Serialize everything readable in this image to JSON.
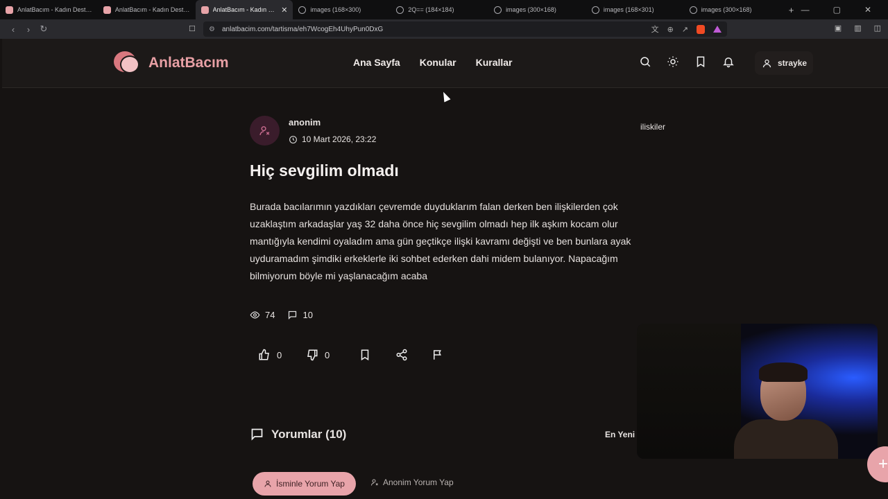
{
  "browser": {
    "tabs": [
      {
        "title": "AnlatBacım - Kadın Destek Platformu",
        "type": "site",
        "active": false
      },
      {
        "title": "AnlatBacım - Kadın Destek Platformu",
        "type": "site",
        "active": false
      },
      {
        "title": "AnlatBacım - Kadın Destek",
        "type": "site",
        "active": true
      },
      {
        "title": "images (168×300)",
        "type": "image",
        "active": false
      },
      {
        "title": "2Q== (184×184)",
        "type": "image",
        "active": false
      },
      {
        "title": "images (300×168)",
        "type": "image",
        "active": false
      },
      {
        "title": "images (168×301)",
        "type": "image",
        "active": false
      },
      {
        "title": "images (300×168)",
        "type": "image",
        "active": false
      }
    ],
    "new_tab": "+",
    "close": "✕",
    "url": "anlatbacim.com/tartisma/eh7WcogEh4UhyPun0DxG"
  },
  "site": {
    "logo_text": "AnlatBacım",
    "nav": [
      "Ana Sayfa",
      "Konular",
      "Kurallar"
    ],
    "username": "strayke"
  },
  "post": {
    "author": "anonim",
    "date": "10 Mart 2026, 23:22",
    "category": "iliskiler",
    "title": "Hiç sevgilim olmadı",
    "body": "Burada bacılarımın yazdıkları çevremde duyduklarım falan derken ben ilişkilerden çok uzaklaştım arkadaşlar yaş 32 daha önce hiç sevgilim olmadı hep ilk aşkım kocam olur mantığıyla kendimi oyaladım ama gün geçtikçe ilişki kavramı değişti ve ben bunlara ayak uyduramadım şimdiki erkeklerle iki sohbet ederken dahi midem bulanıyor. Napacağım bilmiyorum böyle mi yaşlanacağım acaba",
    "views": "74",
    "comment_count": "10",
    "likes": "0",
    "dislikes": "0"
  },
  "comments": {
    "heading": "Yorumlar (10)",
    "sort": "En Yeni",
    "named_button": "İsminle Yorum Yap",
    "anon_button": "Anonim Yorum Yap"
  },
  "colors": {
    "accent": "#e8a4aa",
    "background": "#161312",
    "header": "#1c1918"
  }
}
